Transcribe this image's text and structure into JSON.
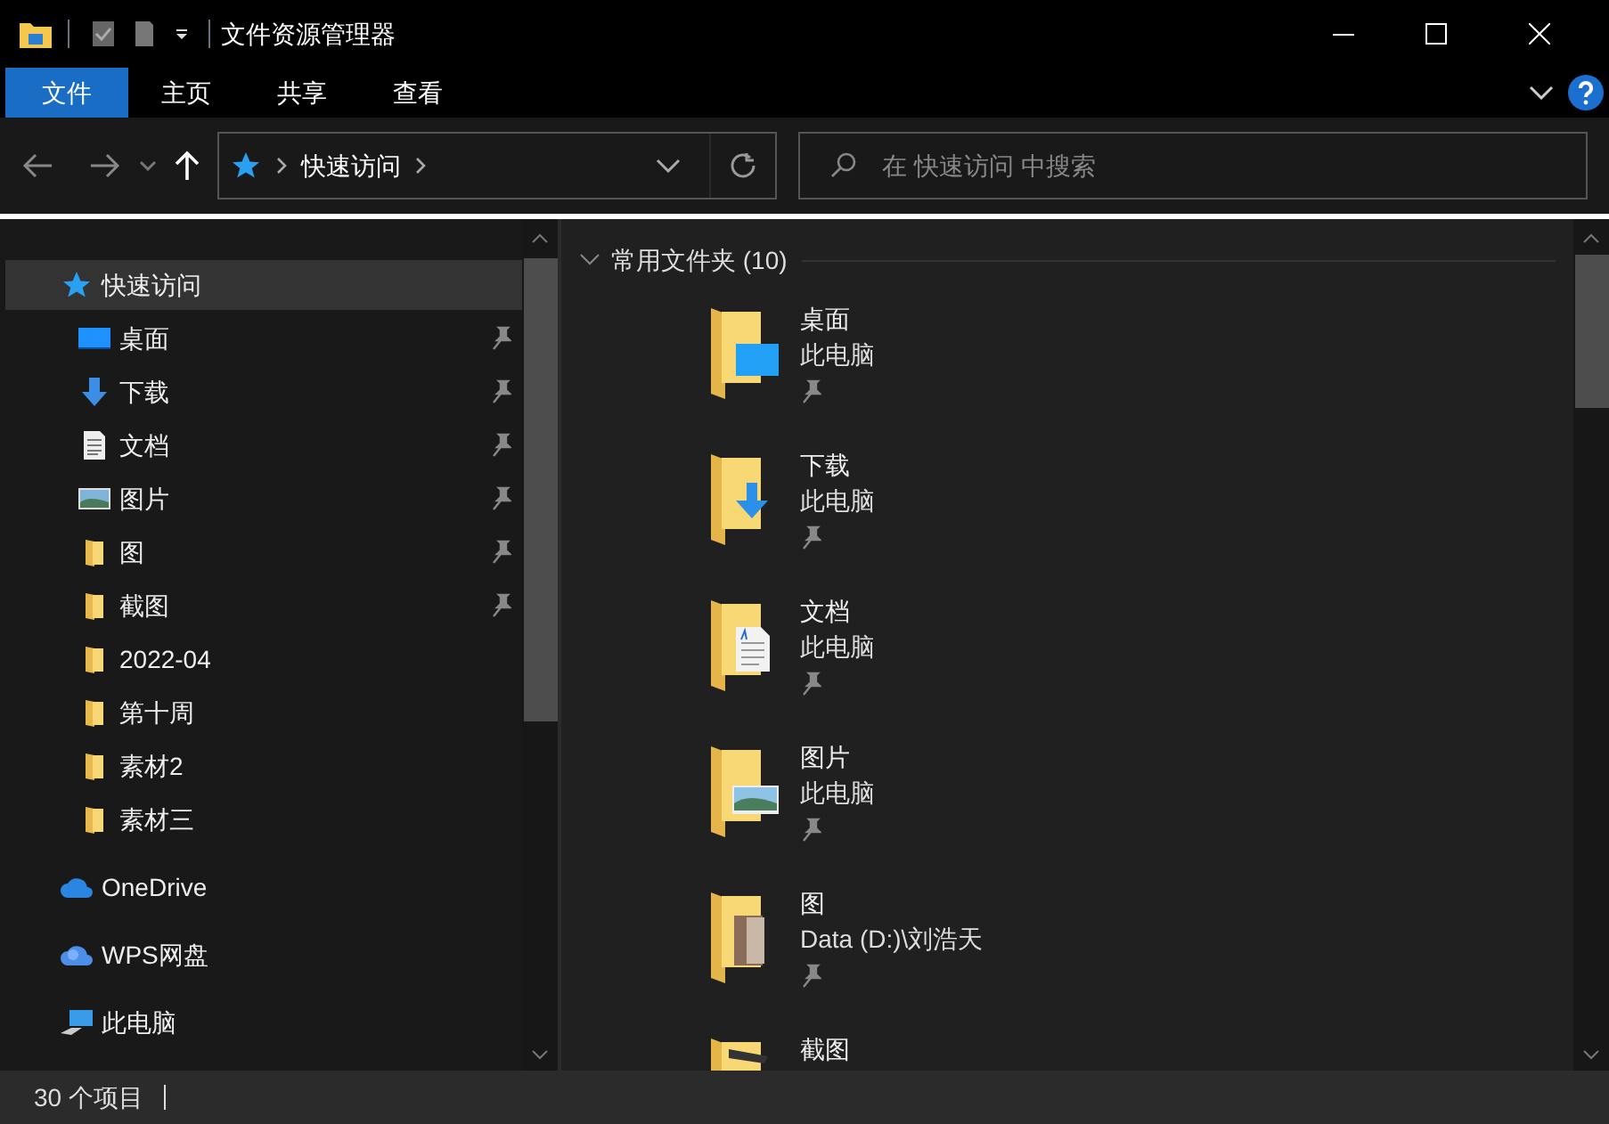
{
  "window": {
    "title": "文件资源管理器"
  },
  "ribbon_tabs": [
    {
      "label": "文件",
      "selected": true
    },
    {
      "label": "主页",
      "selected": false
    },
    {
      "label": "共享",
      "selected": false
    },
    {
      "label": "查看",
      "selected": false
    }
  ],
  "address_bar": {
    "path": "快速访问"
  },
  "search": {
    "placeholder": "在 快速访问 中搜索"
  },
  "sidebar": {
    "items": [
      {
        "label": "快速访问",
        "kind": "quick",
        "selected": true,
        "children": [
          {
            "label": "桌面",
            "kind": "desktop",
            "pinned": true,
            "selected": false
          },
          {
            "label": "下载",
            "kind": "download",
            "pinned": true,
            "selected": false
          },
          {
            "label": "文档",
            "kind": "document",
            "pinned": true,
            "selected": false
          },
          {
            "label": "图片",
            "kind": "picture",
            "pinned": true,
            "selected": false
          },
          {
            "label": "图",
            "kind": "folder",
            "pinned": true,
            "selected": false
          },
          {
            "label": "截图",
            "kind": "folder",
            "pinned": true,
            "selected": false
          },
          {
            "label": "2022-04",
            "kind": "folder",
            "pinned": false,
            "selected": false
          },
          {
            "label": "第十周",
            "kind": "folder",
            "pinned": false,
            "selected": false
          },
          {
            "label": "素材2",
            "kind": "folder",
            "pinned": false,
            "selected": false
          },
          {
            "label": "素材三",
            "kind": "folder",
            "pinned": false,
            "selected": false
          }
        ]
      },
      {
        "label": "OneDrive",
        "kind": "onedrive",
        "selected": false
      },
      {
        "label": "WPS网盘",
        "kind": "wps",
        "selected": false
      },
      {
        "label": "此电脑",
        "kind": "pc",
        "selected": false
      }
    ]
  },
  "group": {
    "title": "常用文件夹 (10)",
    "expanded": true
  },
  "folders": [
    {
      "name": "桌面",
      "location": "此电脑",
      "kind": "desktop",
      "pinned": true
    },
    {
      "name": "下载",
      "location": "此电脑",
      "kind": "download",
      "pinned": true
    },
    {
      "name": "文档",
      "location": "此电脑",
      "kind": "document",
      "pinned": true
    },
    {
      "name": "图片",
      "location": "此电脑",
      "kind": "picture",
      "pinned": true
    },
    {
      "name": "图",
      "location": "Data (D:)\\刘浩天",
      "kind": "photos",
      "pinned": true
    },
    {
      "name": "截图",
      "kind": "screenshots"
    }
  ],
  "status_bar": {
    "count": "30 个项目"
  }
}
